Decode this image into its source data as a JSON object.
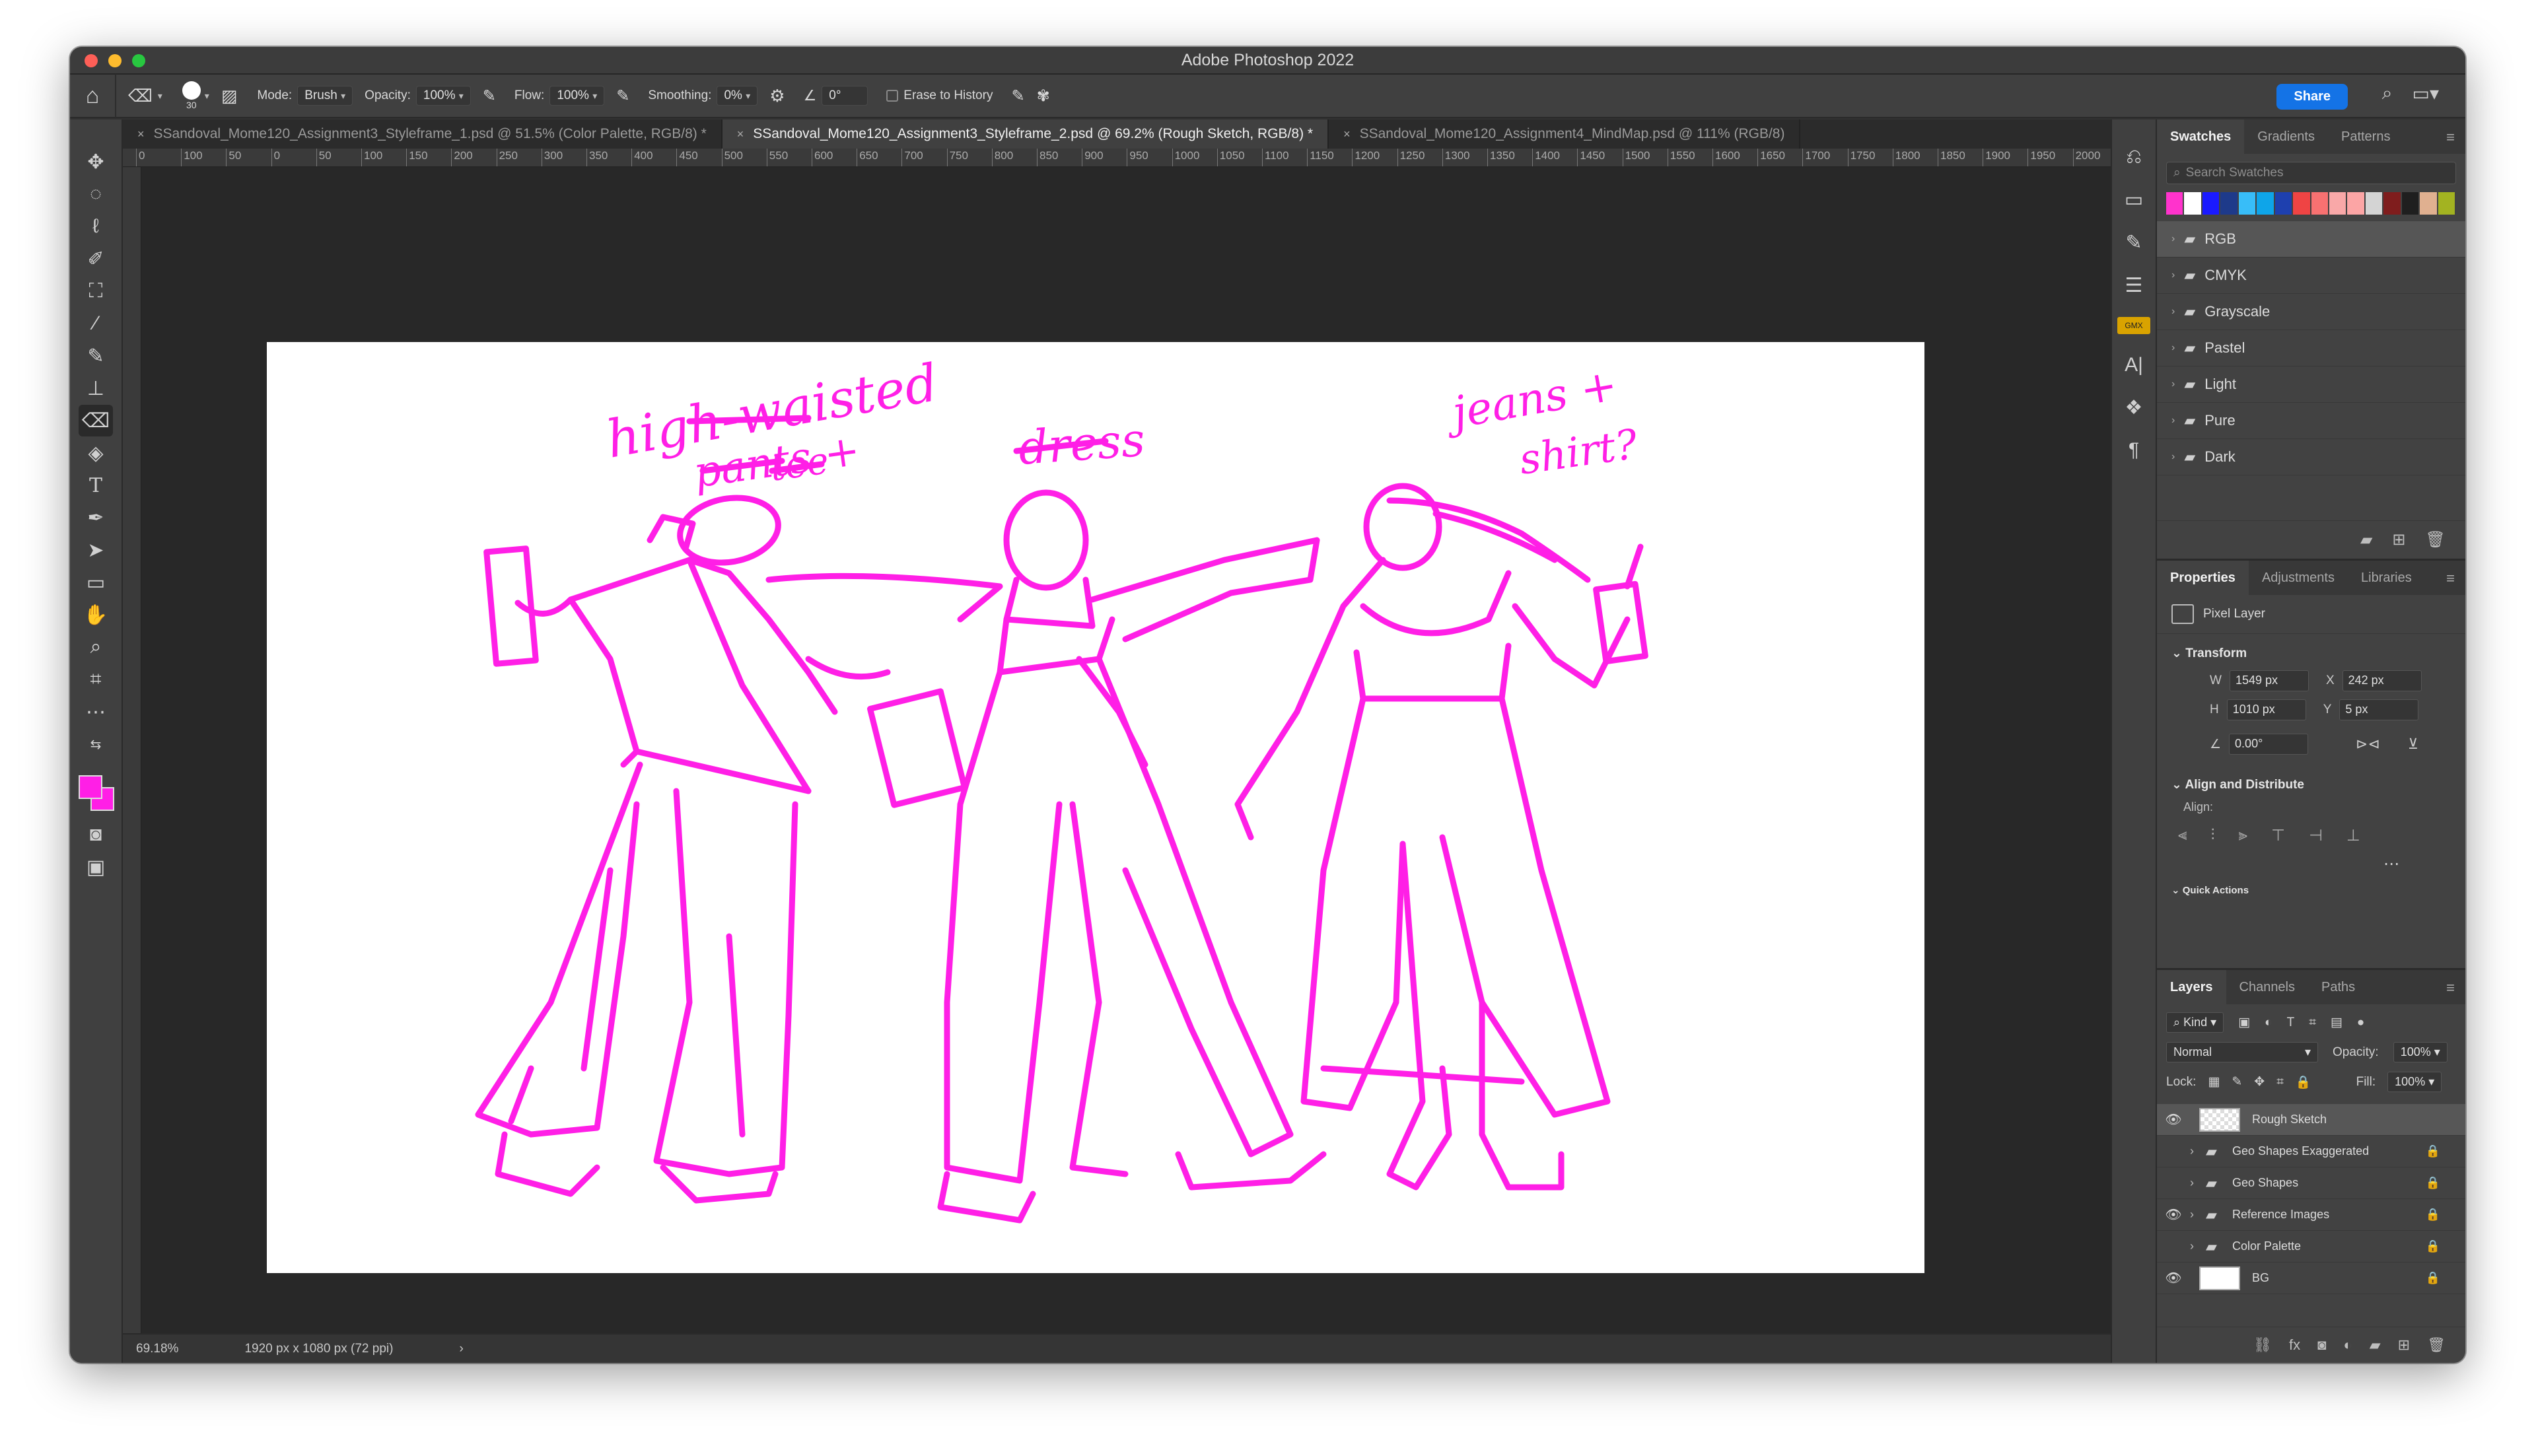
{
  "window": {
    "title": "Adobe Photoshop 2022"
  },
  "options": {
    "brush_size": "30",
    "mode_label": "Mode:",
    "mode_value": "Brush",
    "opacity_label": "Opacity:",
    "opacity_value": "100%",
    "flow_label": "Flow:",
    "flow_value": "100%",
    "smoothing_label": "Smoothing:",
    "smoothing_value": "0%",
    "angle_value": "0°",
    "erase_label": "Erase to History",
    "share_label": "Share"
  },
  "tabs": [
    {
      "label": "SSandoval_Mome120_Assignment3_Styleframe_1.psd @ 51.5% (Color Palette, RGB/8) *",
      "active": false
    },
    {
      "label": "SSandoval_Mome120_Assignment3_Styleframe_2.psd @ 69.2% (Rough Sketch, RGB/8) *",
      "active": true
    },
    {
      "label": "SSandoval_Mome120_Assignment4_MindMap.psd @ 111% (RGB/8)",
      "active": false
    }
  ],
  "ruler": {
    "ticks": [
      "0",
      "100",
      "50",
      "0",
      "50",
      "100",
      "150",
      "200",
      "250",
      "300",
      "350",
      "400",
      "450",
      "500",
      "550",
      "600",
      "650",
      "700",
      "750",
      "800",
      "850",
      "900",
      "950",
      "1000",
      "1050",
      "1100",
      "1150",
      "1200",
      "1250",
      "1300",
      "1350",
      "1400",
      "1450",
      "1500",
      "1550",
      "1600",
      "1650",
      "1700",
      "1750",
      "1800",
      "1850",
      "1900",
      "1950",
      "2000"
    ]
  },
  "colors": {
    "foreground": "#ff1fe6",
    "background": "#ff1fe6",
    "sketch": "#ff1fe6"
  },
  "canvas": {
    "annotations": [
      "high-waisted",
      "pants +",
      "tee",
      "dress",
      "jeans +",
      "shirt?"
    ]
  },
  "status": {
    "zoom": "69.18%",
    "doc_size": "1920 px x 1080 px (72 ppi)"
  },
  "swatches": {
    "tabs": [
      "Swatches",
      "Gradients",
      "Patterns"
    ],
    "search_placeholder": "Search Swatches",
    "recent": [
      "#ff33cc",
      "#ffffff",
      "#1a1aff",
      "#1e3a8a",
      "#38bdf8",
      "#0ea5e9",
      "#1e40af",
      "#ef4444",
      "#f87171",
      "#f9a8a8",
      "#fca5a5",
      "#d4d4d4",
      "#7f1d1d",
      "#1f1f1f",
      "#e0b090",
      "#a3b321"
    ],
    "groups": [
      "RGB",
      "CMYK",
      "Grayscale",
      "Pastel",
      "Light",
      "Pure",
      "Dark"
    ]
  },
  "properties": {
    "tabs": [
      "Properties",
      "Adjustments",
      "Libraries"
    ],
    "layer_type": "Pixel Layer",
    "transform_title": "Transform",
    "w_label": "W",
    "w_value": "1549 px",
    "x_label": "X",
    "x_value": "242 px",
    "h_label": "H",
    "h_value": "1010 px",
    "y_label": "Y",
    "y_value": "5 px",
    "angle_value": "0.00°",
    "align_title": "Align and Distribute",
    "align_label": "Align:",
    "quick_actions": "Quick Actions"
  },
  "layers": {
    "tabs": [
      "Layers",
      "Channels",
      "Paths"
    ],
    "kind_label": "Kind",
    "blend_mode": "Normal",
    "opacity_label": "Opacity:",
    "opacity_value": "100%",
    "lock_label": "Lock:",
    "fill_label": "Fill:",
    "fill_value": "100%",
    "items": [
      {
        "name": "Rough Sketch",
        "visible": true,
        "group": false,
        "selected": true
      },
      {
        "name": "Geo Shapes Exaggerated",
        "visible": false,
        "group": true
      },
      {
        "name": "Geo Shapes",
        "visible": false,
        "group": true
      },
      {
        "name": "Reference Images",
        "visible": true,
        "group": true
      },
      {
        "name": "Color Palette",
        "visible": false,
        "group": true
      },
      {
        "name": "BG",
        "visible": true,
        "group": false
      }
    ]
  }
}
